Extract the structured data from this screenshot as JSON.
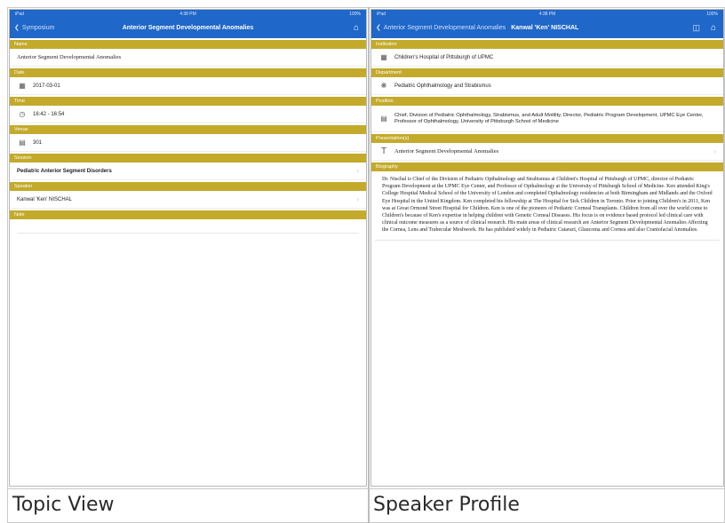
{
  "captions": {
    "left": "Topic View",
    "right": "Speaker Profile"
  },
  "status_bar": {
    "carrier": "iPad",
    "time": "4:38 PM",
    "battery": "100%"
  },
  "left": {
    "nav": {
      "back_label": "Symposium",
      "title": "Anterior Segment Developmental Anomalies"
    },
    "sections": {
      "name": "Name",
      "date": "Date",
      "time": "Time",
      "venue": "Venue",
      "session": "Session",
      "speaker": "Speaker",
      "note": "Note"
    },
    "name_value": "Anterior Segment Developmental Anomalies",
    "date_value": "2017-03-01",
    "time_value": "16:42 - 16:54",
    "venue_value": "301",
    "session_value": "Pediatric Anterior Segment Disorders",
    "speaker_value": "Kanwal 'Ken' NISCHAL"
  },
  "right": {
    "nav": {
      "back_label": "Anterior Segment Developmental Anomalies",
      "title": "Kanwal 'Ken' NISCHAL"
    },
    "sections": {
      "institution": "Institution",
      "department": "Department",
      "position": "Position",
      "presentations": "Presentation(s)",
      "biography": "Biography"
    },
    "institution_value": "Children's Hospital of Pittsburgh of UPMC",
    "department_value": "Pediatric Ophthalmology and Strabismus",
    "position_value": "Chief, Division of Pediatric Ophthalmology, Strabismus, and Adult Motility, Director, Pediatric Program Development, UPMC Eye Center, Professor of Ophthalmology, University of Pittsburgh School of Medicine",
    "presentation_value": "Anterior Segment Developmental Anomalies",
    "biography_value": "Dr. Nischal is Chief of the Division of Pediatric Opthalmology and Strabismus at Children's Hospital of Pittsburgh of UPMC, director of Pediatric Program Development at the UPMC Eye Center, and Professor of Opthalmology at the University of Pittsburgh School of Medicine. Ken attended King's College Hospital Medical School of the University of London and completed Opthalmology residencies at both Birmingham and Midlands and the Oxford Eye Hospital in the United Kingdom. Ken completed his fellowship at The Hospital for Sick Children in Toronto. Prior to joining Children's in 2011, Ken was at Great Ormond Street Hospital for Children. Ken is one of the pioneers of Pediatric Corneal Transplants. Children from all over the world come to Children's because of Ken's expertise in helping children with Genetic Corneal Diseases. His focus is on evidence based protocol led clinical care with clinical outcome measures as a source of clinical research. His main areas of clinical research are Anterior Segment Developmental Anomalies Affecting the Cornea, Lens and Trabecular Meshwork. He has published widely in Pediatric Cataract, Glaucoma and Cornea and also Craniofacial Anomalies."
  },
  "colors": {
    "nav_blue": "#1f67c8",
    "section_gold": "#c3aa2a"
  }
}
